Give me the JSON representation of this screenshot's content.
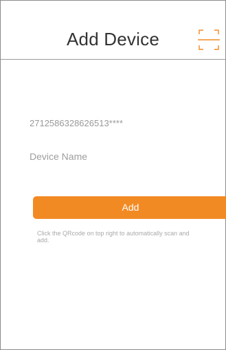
{
  "header": {
    "title": "Add Device",
    "scan_icon": "qr-scan-frame-icon"
  },
  "form": {
    "serial_value": "2712586328626513****",
    "device_name_placeholder": "Device Name",
    "device_name_value": ""
  },
  "actions": {
    "add_label": "Add"
  },
  "hint": {
    "text": "Click the QRcode on top right to automatically scan and add."
  },
  "colors": {
    "accent": "#f28a24",
    "placeholder": "#999999",
    "title": "#333333"
  }
}
